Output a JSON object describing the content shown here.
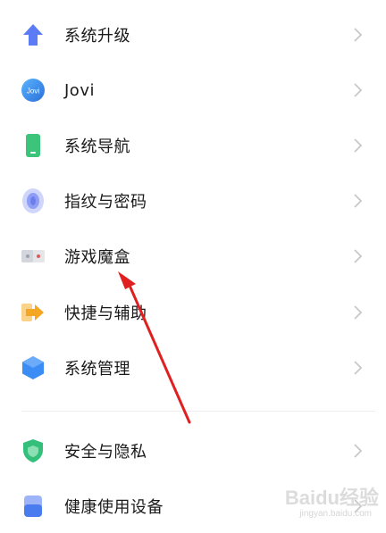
{
  "settings": {
    "items": [
      {
        "label": "系统升级",
        "icon": "upgrade-arrow-icon"
      },
      {
        "label": "Jovi",
        "icon": "jovi-icon",
        "icon_text": "Jovi"
      },
      {
        "label": "系统导航",
        "icon": "navigation-phone-icon"
      },
      {
        "label": "指纹与密码",
        "icon": "fingerprint-icon"
      },
      {
        "label": "游戏魔盒",
        "icon": "game-box-icon"
      },
      {
        "label": "快捷与辅助",
        "icon": "shortcut-arrow-icon"
      },
      {
        "label": "系统管理",
        "icon": "system-management-hexagon-icon"
      },
      {
        "label": "安全与隐私",
        "icon": "shield-icon"
      },
      {
        "label": "健康使用设备",
        "icon": "health-device-icon"
      }
    ]
  },
  "watermark": {
    "brand": "Baidu经验",
    "url": "jingyan.baidu.com"
  },
  "colors": {
    "upgrade": "#5b7cf5",
    "jovi": "#3a8ee8",
    "nav": "#3cc47a",
    "fingerprint": "#7a8cf0",
    "shortcut": "#f5a623",
    "system": "#3b8cf5",
    "shield": "#34c07a",
    "health": "#4a7cf0",
    "arrow": "#e02020"
  }
}
